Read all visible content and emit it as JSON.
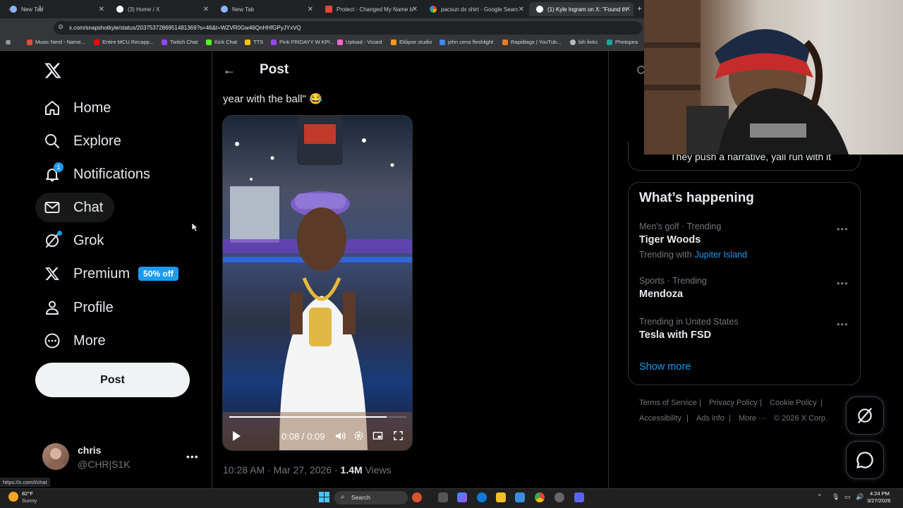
{
  "browser": {
    "tabs": [
      {
        "title": "New Tab",
        "favicon_color": "#8ab4f8"
      },
      {
        "title": "(3) Home / X",
        "favicon_color": "#ffffff"
      },
      {
        "title": "New Tab",
        "favicon_color": "#8ab4f8"
      },
      {
        "title": "Protect - Changed My Name b",
        "favicon_color": "#e8453c"
      },
      {
        "title": "pacsun dx shirt - Google Search",
        "favicon_color": "#34a853"
      },
      {
        "title": "(1) Kyle Ingram on X: \"Found th",
        "favicon_color": "#ffffff"
      }
    ],
    "url": "x.com/snapshotkyle/status/2037537286951481369?s=46&t=WZVR0Gw46QnHHfGPyJYxVQ",
    "bookmarks": [
      {
        "label": "Music Nerd - Name...",
        "color": "#e74c3c"
      },
      {
        "label": "Entire MCU Recapp...",
        "color": "#ff0000"
      },
      {
        "label": "Twitch Chat",
        "color": "#9146ff"
      },
      {
        "label": "Kick Chat",
        "color": "#53fc18"
      },
      {
        "label": "TTS",
        "color": "#f1c40f"
      },
      {
        "label": "Pink FRIDAYY W KPI...",
        "color": "#9146ff"
      },
      {
        "label": "Upload - Vizard",
        "color": "#ff66cc"
      },
      {
        "label": "Eklipse studio",
        "color": "#f39c12"
      },
      {
        "label": "john cena fleshlight",
        "color": "#4285f4"
      },
      {
        "label": "Rapidtags | YouTub...",
        "color": "#e67e22"
      },
      {
        "label": "bih links",
        "color": "#bbbbbb"
      },
      {
        "label": "Photopea",
        "color": "#18a497"
      }
    ]
  },
  "nav": {
    "items": [
      {
        "label": "Home",
        "icon": "home-icon"
      },
      {
        "label": "Explore",
        "icon": "search-icon"
      },
      {
        "label": "Notifications",
        "icon": "bell-icon"
      },
      {
        "label": "Chat",
        "icon": "mail-icon"
      },
      {
        "label": "Grok",
        "icon": "grok-icon"
      },
      {
        "label": "Premium",
        "icon": "x-icon"
      },
      {
        "label": "Profile",
        "icon": "person-icon"
      },
      {
        "label": "More",
        "icon": "more-circle-icon"
      }
    ],
    "notifications_count": "1",
    "premium_badge": "50% off",
    "post_button": "Post"
  },
  "account": {
    "name": "chris",
    "handle": "@CHR|S1K"
  },
  "post": {
    "header": "Post",
    "text": "year with the ball\" 😂",
    "video": {
      "time": "0:08 / 0:09",
      "progress": 0.89
    },
    "timestamp": "10:28 AM · Mar 27, 2026 · ",
    "views_count": "1.4M",
    "views_label": " Views"
  },
  "sidebar": {
    "top_card_text": "They push a narrative, yall run with it",
    "trends_title": "What’s happening",
    "trends": [
      {
        "context": "Men's golf · Trending",
        "name": "Tiger Woods",
        "sub_prefix": "Trending with",
        "sub_link": "Jupiter Island"
      },
      {
        "context": "Sports · Trending",
        "name": "Mendoza",
        "sub_prefix": "",
        "sub_link": ""
      },
      {
        "context": "Trending in United States",
        "name": "Tesla with FSD",
        "sub_prefix": "",
        "sub_link": ""
      }
    ],
    "show_more": "Show more",
    "footer": [
      "Terms of Service",
      "Privacy Policy",
      "Cookie Policy",
      "Accessibility",
      "Ads info",
      "More ···",
      "© 2026 X Corp."
    ]
  },
  "status_url": "https://x.com/i/chat",
  "taskbar": {
    "weather_temp": "82°F",
    "weather_desc": "Sunny",
    "search_label": "Search",
    "time": "4:24 PM",
    "date": "3/27/2026"
  },
  "colors": {
    "accent": "#1d9bf0",
    "background": "#000000",
    "border": "#2f3336",
    "muted_text": "#71767b"
  }
}
